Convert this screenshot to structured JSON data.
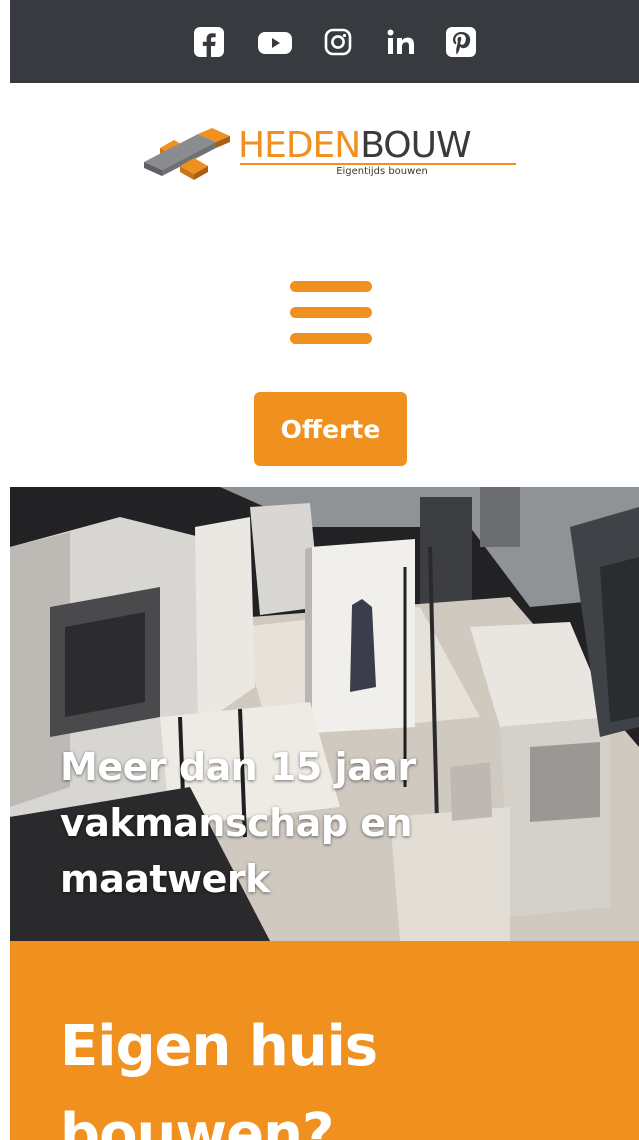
{
  "social": {
    "facebook": "facebook-icon",
    "youtube": "youtube-icon",
    "instagram": "instagram-icon",
    "linkedin": "linkedin-icon",
    "pinterest": "pinterest-icon"
  },
  "logo": {
    "name_part1": "HEDEN",
    "name_part2": "BOUW",
    "tagline": "Eigentijds bouwen"
  },
  "menu": {
    "icon": "hamburger-menu-icon"
  },
  "cta": {
    "offerte_label": "Offerte"
  },
  "hero": {
    "heading": "Meer dan 15 jaar vakmanschap en maatwerk"
  },
  "section": {
    "title": "Eigen huis bouwen?"
  },
  "colors": {
    "accent": "#f0901e",
    "topbar": "#373a3f",
    "text_dark": "#3a3a3a",
    "white": "#ffffff"
  }
}
